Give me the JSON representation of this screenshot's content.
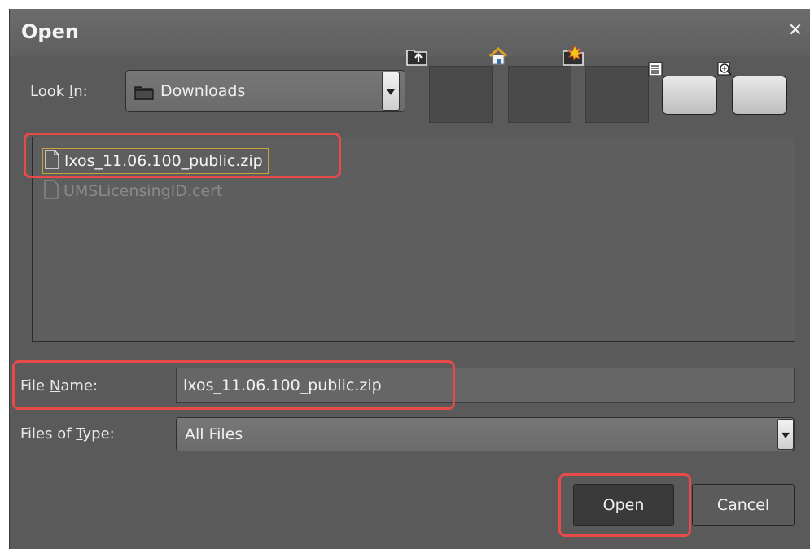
{
  "window": {
    "title": "Open",
    "close_glyph": "✕"
  },
  "look_in": {
    "label_pre": "Look ",
    "label_mnemonic": "I",
    "label_post": "n:",
    "value": "Downloads",
    "icon": "folder-icon"
  },
  "toolbar": {
    "buttons": [
      {
        "name": "up-one-level-button",
        "icon": "folder-up-icon"
      },
      {
        "name": "home-button",
        "icon": "home-icon"
      },
      {
        "name": "new-folder-button",
        "icon": "new-folder-icon"
      },
      {
        "name": "list-view-button",
        "icon": "list-view-icon"
      },
      {
        "name": "details-view-button",
        "icon": "details-view-icon"
      }
    ]
  },
  "files": [
    {
      "name": "lxos_11.06.100_public.zip",
      "selected": true,
      "icon": "file-icon"
    },
    {
      "name": "UMSLicensingID.cert",
      "selected": false,
      "icon": "file-icon"
    }
  ],
  "file_name": {
    "label_pre": "File ",
    "label_mnemonic": "N",
    "label_post": "ame:",
    "value": "lxos_11.06.100_public.zip"
  },
  "file_type": {
    "label_pre": "Files of ",
    "label_mnemonic": "T",
    "label_post": "ype:",
    "value": "All Files"
  },
  "actions": {
    "open_label": "Open",
    "cancel_label": "Cancel"
  },
  "colors": {
    "dialog_bg": "#5a5a5a",
    "highlight": "#e84a4a",
    "selection_border": "#c9a23c"
  }
}
